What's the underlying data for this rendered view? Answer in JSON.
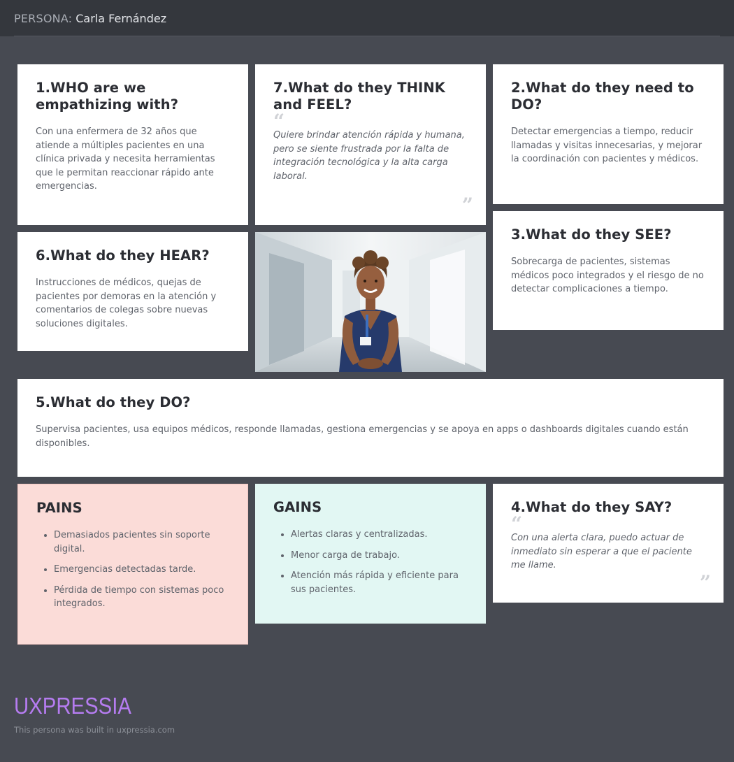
{
  "header": {
    "label": "PERSONA:",
    "name": "Carla Fernández"
  },
  "cards": {
    "who": {
      "title": "1.WHO are we empathizing with?",
      "text": "Con una enfermera de 32 años que atiende a múltiples pacientes en una clínica privada y necesita herramientas que le permitan reaccionar rápido ante emergencias."
    },
    "think": {
      "title": "7.What do they THINK and FEEL?",
      "quote": "Quiere brindar atención rápida y humana, pero se siente frustrada por la falta de integración tecnológica y la alta carga laboral."
    },
    "need": {
      "title": "2.What do they need to DO?",
      "text": "Detectar emergencias a tiempo, reducir llamadas y visitas innecesarias, y mejorar la coordinación con pacientes y médicos."
    },
    "hear": {
      "title": "6.What do they HEAR?",
      "text": "Instrucciones de médicos, quejas de pacientes por demoras en la atención y comentarios de colegas sobre nuevas soluciones digitales."
    },
    "see": {
      "title": "3.What do they SEE?",
      "text": "Sobrecarga de pacientes, sistemas médicos poco integrados y el riesgo de no detectar complicaciones a tiempo."
    },
    "do": {
      "title": "5.What do they DO?",
      "text": "Supervisa pacientes, usa equipos médicos, responde llamadas, gestiona emergencias y se apoya en apps o dashboards digitales cuando están disponibles."
    },
    "pains": {
      "title": "PAINS",
      "items": [
        "Demasiados pacientes sin soporte digital.",
        "Emergencias detectadas tarde.",
        "Pérdida de tiempo con sistemas poco integrados."
      ]
    },
    "gains": {
      "title": "GAINS",
      "items": [
        "Alertas claras y centralizadas.",
        "Menor carga de trabajo.",
        "Atención más rápida y eficiente para sus pacientes."
      ]
    },
    "say": {
      "title": "4.What do they SAY?",
      "quote": "Con una alerta clara, puedo actuar de inmediato sin esperar a que el paciente me llame."
    }
  },
  "quote_marks": {
    "open": "“",
    "close": "”"
  },
  "footer": {
    "logo": "UXPRESSIA",
    "text": "This persona was built in uxpressia.com"
  },
  "colors": {
    "background": "#474a52",
    "header": "#34373d",
    "pains": "#fbdcd8",
    "gains": "#e2f7f3",
    "logo": "#b57cf0"
  },
  "icons": [
    "quote-open-icon",
    "quote-close-icon"
  ]
}
